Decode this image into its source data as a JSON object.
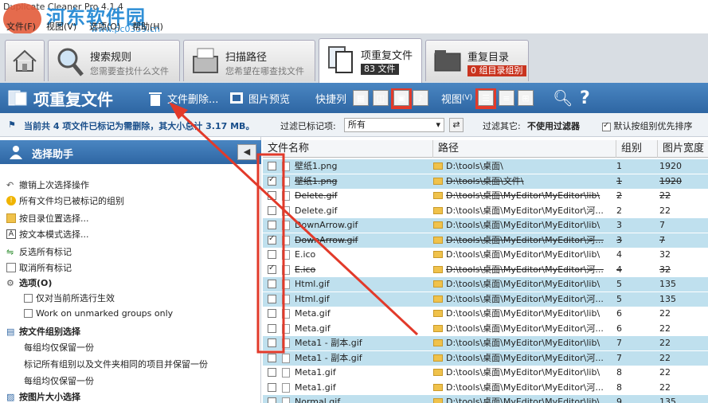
{
  "window": {
    "title": "Duplicate Cleaner Pro 4.1.4"
  },
  "watermark": {
    "text": "河东软件园",
    "url": "www.pc0359.cn"
  },
  "menu": [
    "文件(F)",
    "视图(V)",
    "选项(O)",
    "帮助(H)"
  ],
  "tabs": [
    {
      "title": "",
      "sub": ""
    },
    {
      "title": "搜索规则",
      "sub": "您需要查找什么文件"
    },
    {
      "title": "扫描路径",
      "sub": "您希望在哪查找文件"
    },
    {
      "title": "项重复文件",
      "badge": "83 文件"
    },
    {
      "title": "重复目录",
      "badge": "0 组目录组别"
    }
  ],
  "toolbar": {
    "title": "项重复文件",
    "delete_label": "文件删除...",
    "preview_label": "图片预览",
    "quick_cols_label": "快捷列",
    "view_label": "视图",
    "view_mode": "(V)"
  },
  "status": {
    "marked_text": "当前共 4 项文件已标记为需删除，其大小总计 3.17 MB。",
    "filter_label": "过滤已标记项:",
    "filter_value": "所有",
    "filter_other_label": "过滤其它:",
    "filter_other_value": "不使用过滤器",
    "group_priority_label": "默认按组别优先排序"
  },
  "assistant": {
    "title": "选择助手",
    "items": [
      "撤销上次选择操作",
      "所有文件均已被标记的组别",
      "按目录位置选择...",
      "按文本模式选择...",
      "反选所有标记",
      "取消所有标记"
    ],
    "options_heading": "选项(O)",
    "option_current": "仅对当前所选行生效",
    "option_unmarked": "Work on unmarked groups only",
    "group_heading": "按文件组别选择",
    "group_items": [
      "每组均仅保留一份",
      "标记所有组别以及文件夹相同的项目并保留一份",
      "每组均仅保留一份"
    ],
    "image_heading": "按图片大小选择"
  },
  "grid": {
    "columns": [
      "文件名称",
      "路径",
      "组别",
      "图片宽度"
    ],
    "rows": [
      {
        "name": "壁纸1.png",
        "path": "D:\\tools\\桌面\\",
        "group": "1",
        "width": "1920",
        "checked": false,
        "struck": false,
        "shade": "blue"
      },
      {
        "name": "壁纸1.png",
        "path": "D:\\tools\\桌面\\文件\\",
        "group": "1",
        "width": "1920",
        "checked": true,
        "struck": true,
        "shade": "blue"
      },
      {
        "name": "Delete.gif",
        "path": "D:\\tools\\桌面\\MyEditor\\MyEditor\\lib\\",
        "group": "2",
        "width": "22",
        "checked": false,
        "struck": true,
        "shade": "white"
      },
      {
        "name": "Delete.gif",
        "path": "D:\\tools\\桌面\\MyEditor\\MyEditor\\河...",
        "group": "2",
        "width": "22",
        "checked": false,
        "struck": false,
        "shade": "white"
      },
      {
        "name": "DownArrow.gif",
        "path": "D:\\tools\\桌面\\MyEditor\\MyEditor\\lib\\",
        "group": "3",
        "width": "7",
        "checked": false,
        "struck": false,
        "shade": "blue"
      },
      {
        "name": "DownArrow.gif",
        "path": "D:\\tools\\桌面\\MyEditor\\MyEditor\\河...",
        "group": "3",
        "width": "7",
        "checked": true,
        "struck": true,
        "shade": "blue"
      },
      {
        "name": "E.ico",
        "path": "D:\\tools\\桌面\\MyEditor\\MyEditor\\lib\\",
        "group": "4",
        "width": "32",
        "checked": false,
        "struck": false,
        "shade": "white"
      },
      {
        "name": "E.ico",
        "path": "D:\\tools\\桌面\\MyEditor\\MyEditor\\河...",
        "group": "4",
        "width": "32",
        "checked": true,
        "struck": true,
        "shade": "white"
      },
      {
        "name": "Html.gif",
        "path": "D:\\tools\\桌面\\MyEditor\\MyEditor\\lib\\",
        "group": "5",
        "width": "135",
        "checked": false,
        "struck": false,
        "shade": "blue"
      },
      {
        "name": "Html.gif",
        "path": "D:\\tools\\桌面\\MyEditor\\MyEditor\\河...",
        "group": "5",
        "width": "135",
        "checked": false,
        "struck": false,
        "shade": "blue"
      },
      {
        "name": "Meta.gif",
        "path": "D:\\tools\\桌面\\MyEditor\\MyEditor\\lib\\",
        "group": "6",
        "width": "22",
        "checked": false,
        "struck": false,
        "shade": "white"
      },
      {
        "name": "Meta.gif",
        "path": "D:\\tools\\桌面\\MyEditor\\MyEditor\\河...",
        "group": "6",
        "width": "22",
        "checked": false,
        "struck": false,
        "shade": "white"
      },
      {
        "name": "Meta1 - 副本.gif",
        "path": "D:\\tools\\桌面\\MyEditor\\MyEditor\\lib\\",
        "group": "7",
        "width": "22",
        "checked": false,
        "struck": false,
        "shade": "blue"
      },
      {
        "name": "Meta1 - 副本.gif",
        "path": "D:\\tools\\桌面\\MyEditor\\MyEditor\\河...",
        "group": "7",
        "width": "22",
        "checked": false,
        "struck": false,
        "shade": "blue"
      },
      {
        "name": "Meta1.gif",
        "path": "D:\\tools\\桌面\\MyEditor\\MyEditor\\lib\\",
        "group": "8",
        "width": "22",
        "checked": false,
        "struck": false,
        "shade": "white"
      },
      {
        "name": "Meta1.gif",
        "path": "D:\\tools\\桌面\\MyEditor\\MyEditor\\河...",
        "group": "8",
        "width": "22",
        "checked": false,
        "struck": false,
        "shade": "white"
      },
      {
        "name": "Normal.gif",
        "path": "D:\\tools\\桌面\\MyEditor\\MyEditor\\lib\\",
        "group": "9",
        "width": "135",
        "checked": false,
        "struck": false,
        "shade": "blue"
      }
    ]
  },
  "colors": {
    "toolbar_blue": "#2e66a3",
    "row_blue": "#bfe0ee",
    "annotation_red": "#e23a2a"
  }
}
